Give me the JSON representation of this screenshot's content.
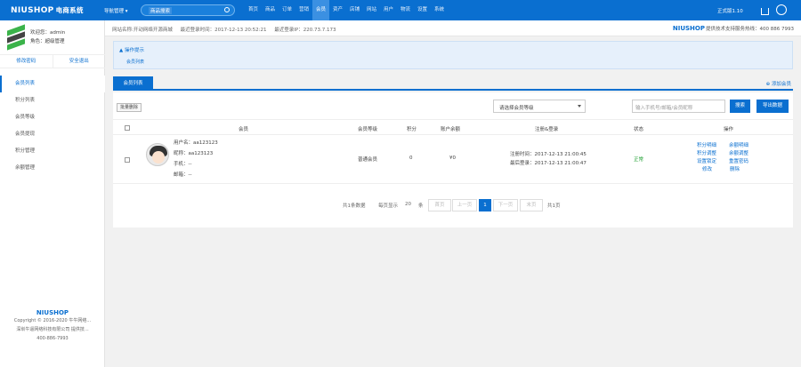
{
  "topbar": {
    "logo": "NIUSHOP",
    "system_name": "电商系统",
    "quick_nav": "导航管理",
    "search_placeholder": "商品搜索",
    "nav": [
      "首页",
      "商品",
      "订单",
      "营销",
      "会员",
      "资产",
      "店铺",
      "网站",
      "用户",
      "物流",
      "设置",
      "系统"
    ],
    "active_nav": "会员",
    "version": "正式版1.10"
  },
  "sidebar": {
    "welcome": "欢迎您：admin",
    "role": "角色：超级管理",
    "modify_password": "修改密码",
    "safe_logout": "安全退出",
    "menu": [
      "会员列表",
      "积分列表",
      "会员等级",
      "会员提现",
      "积分管理",
      "余额管理"
    ],
    "active_menu": "会员列表",
    "footer_logo": "NIUSHOP",
    "copyright": "Copyright © 2016-2020 牛牛网络...",
    "company": "深圳牛逼网络科技有限公司 提供技...",
    "phone": "400-886-7993"
  },
  "infobar": {
    "site_name": "网站名称:开动网络开源商城",
    "last_login_time": "最近登录时间：2017-12-13 20:52:21",
    "last_login_ip": "最近登录IP：220.73.7.173",
    "support_brand": "NIUSHOP",
    "support": "提供技术支持服务热线：400 886 7993"
  },
  "tips": {
    "title": "操作提示",
    "text": "会员列表"
  },
  "tabs": {
    "active": "会员列表",
    "add_member": "添加会员"
  },
  "toolbar": {
    "batch_delete": "批量删除",
    "level_select": "请选择会员等级",
    "keyword_placeholder": "输入手机号/邮箱/会员昵称",
    "search": "搜索",
    "export": "导出数据"
  },
  "table": {
    "headers": [
      "会员",
      "会员等级",
      "积分",
      "账户余额",
      "注册&登录",
      "状态",
      "操作"
    ],
    "rows": [
      {
        "username": "用户名：aa123123",
        "nickname": "昵称：aa123123",
        "phone": "手机：--",
        "email": "邮箱：--",
        "level": "普通会员",
        "points": "0",
        "balance": "¥0",
        "register_time": "注册时间：2017-12-13 21:00:45",
        "last_login": "最后登录：2017-12-13 21:00:47",
        "status": "正常",
        "actions": [
          "积分明细",
          "余额明细",
          "积分调整",
          "余额调整",
          "设置锁定",
          "重置密码",
          "修改",
          "删除"
        ]
      }
    ]
  },
  "pager": {
    "total": "共1条数据",
    "per_page_label": "每页显示",
    "per_page": "20",
    "per_page_unit": "条",
    "first": "首页",
    "prev": "上一页",
    "current": "1",
    "next": "下一页",
    "last": "末页",
    "pages": "共1页"
  },
  "colors": {
    "primary": "#0a6fd0",
    "status_ok": "#1a9e2e",
    "logo_green": "#3bb34a"
  }
}
